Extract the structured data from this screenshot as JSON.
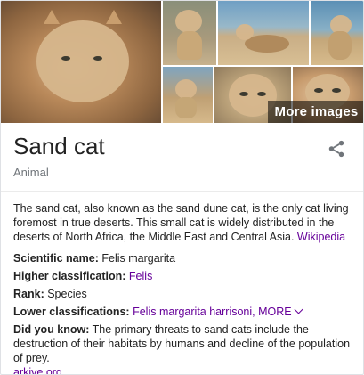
{
  "gallery": {
    "more_images_label": "More images",
    "images": [
      "sand-cat-portrait",
      "sand-cat-kitten",
      "sand-cat-walking",
      "sand-cat-standing",
      "sand-cat-kitten-sitting",
      "sand-cat-face-closeup",
      "sand-cat-resting"
    ]
  },
  "header": {
    "title": "Sand cat",
    "subtitle": "Animal",
    "share_icon": "share-icon"
  },
  "description": {
    "text": "The sand cat, also known as the sand dune cat, is the only cat living foremost in true deserts. This small cat is widely distributed in the deserts of North Africa, the Middle East and Central Asia. ",
    "source_link": "Wikipedia"
  },
  "facts": {
    "scientific_name": {
      "label": "Scientific name:",
      "value": "Felis margarita"
    },
    "higher_classification": {
      "label": "Higher classification:",
      "value": "Felis"
    },
    "rank": {
      "label": "Rank:",
      "value": "Species"
    },
    "lower_classifications": {
      "label": "Lower classifications:",
      "value": "Felis margarita harrisoni",
      "more": "MORE"
    },
    "did_you_know": {
      "label": "Did you know:",
      "value": "The primary threats to sand cats include the destruction of their habitats by humans and decline of the population of prey.",
      "source_link": "arkive.org"
    }
  },
  "colors": {
    "link": "#660099",
    "title": "#222222",
    "subtitle": "#70757a",
    "overlay": "rgba(0,0,0,0.55)"
  }
}
